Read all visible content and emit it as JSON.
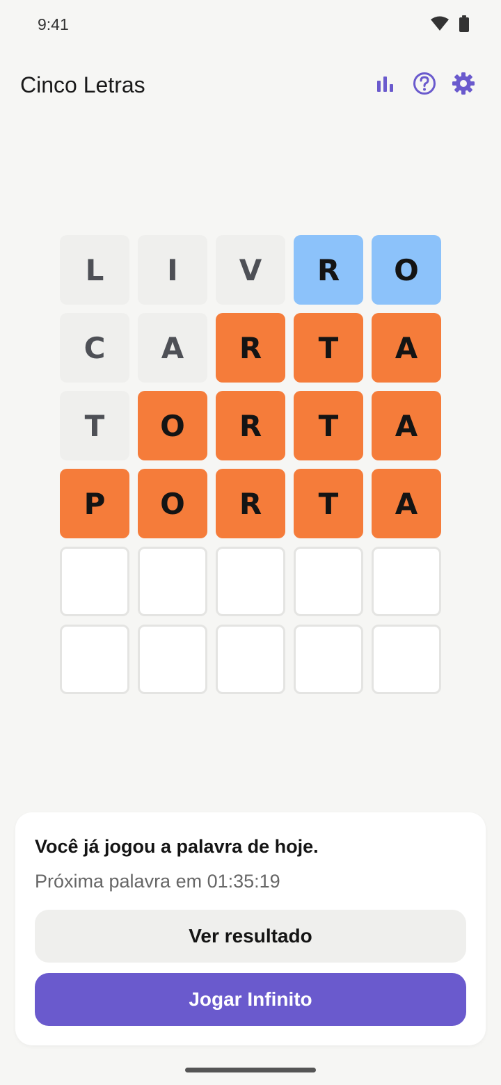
{
  "status_bar": {
    "time": "9:41",
    "icons": [
      "wifi-icon",
      "battery-icon"
    ]
  },
  "app_bar": {
    "title": "Cinco Letras",
    "actions": [
      "stats-icon",
      "help-icon",
      "settings-icon"
    ],
    "accent_color": "#6a5acd"
  },
  "board": {
    "rows": [
      [
        {
          "letter": "L",
          "state": "absent"
        },
        {
          "letter": "I",
          "state": "absent"
        },
        {
          "letter": "V",
          "state": "absent"
        },
        {
          "letter": "R",
          "state": "present"
        },
        {
          "letter": "O",
          "state": "present"
        }
      ],
      [
        {
          "letter": "C",
          "state": "absent"
        },
        {
          "letter": "A",
          "state": "absent"
        },
        {
          "letter": "R",
          "state": "correct"
        },
        {
          "letter": "T",
          "state": "correct"
        },
        {
          "letter": "A",
          "state": "correct"
        }
      ],
      [
        {
          "letter": "T",
          "state": "absent"
        },
        {
          "letter": "O",
          "state": "correct"
        },
        {
          "letter": "R",
          "state": "correct"
        },
        {
          "letter": "T",
          "state": "correct"
        },
        {
          "letter": "A",
          "state": "correct"
        }
      ],
      [
        {
          "letter": "P",
          "state": "correct"
        },
        {
          "letter": "O",
          "state": "correct"
        },
        {
          "letter": "R",
          "state": "correct"
        },
        {
          "letter": "T",
          "state": "correct"
        },
        {
          "letter": "A",
          "state": "correct"
        }
      ],
      [
        {
          "letter": "",
          "state": "empty"
        },
        {
          "letter": "",
          "state": "empty"
        },
        {
          "letter": "",
          "state": "empty"
        },
        {
          "letter": "",
          "state": "empty"
        },
        {
          "letter": "",
          "state": "empty"
        }
      ],
      [
        {
          "letter": "",
          "state": "empty"
        },
        {
          "letter": "",
          "state": "empty"
        },
        {
          "letter": "",
          "state": "empty"
        },
        {
          "letter": "",
          "state": "empty"
        },
        {
          "letter": "",
          "state": "empty"
        }
      ]
    ],
    "colors": {
      "absent": "#efefed",
      "present": "#8cc2fa",
      "correct": "#f57c3a",
      "empty": "#ffffff"
    }
  },
  "result_card": {
    "heading": "Você já jogou a palavra de hoje.",
    "next_word": "Próxima palavra em 01:35:19",
    "view_result_label": "Ver resultado",
    "play_infinite_label": "Jogar Infinito"
  }
}
